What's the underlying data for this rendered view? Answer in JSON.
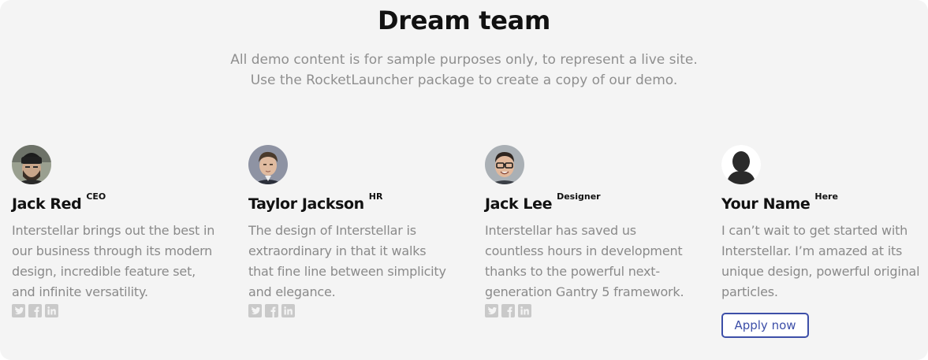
{
  "section": {
    "title": "Dream team",
    "subtitle_lines": [
      "All demo content is for sample purposes only, to represent a live site.",
      "Use the RocketLauncher package to create a copy of our demo."
    ]
  },
  "members": [
    {
      "name": "Jack Red",
      "role": "CEO",
      "description": "Interstellar brings out the best in our business through its modern design, incredible feature set, and infinite versatility.",
      "avatar": "photo-man-beanie-beard",
      "socials": [
        "twitter-icon",
        "facebook-icon",
        "linkedin-icon"
      ]
    },
    {
      "name": "Taylor Jackson",
      "role": "HR",
      "description": "The design of Interstellar is extraordinary in that it walks that fine line between simplicity and elegance.",
      "avatar": "photo-young-man",
      "socials": [
        "twitter-icon",
        "facebook-icon",
        "linkedin-icon"
      ]
    },
    {
      "name": "Jack Lee",
      "role": "Designer",
      "description": "Interstellar has saved us countless hours in development thanks to the powerful next-generation Gantry 5 framework.",
      "avatar": "photo-man-glasses",
      "socials": [
        "twitter-icon",
        "facebook-icon",
        "linkedin-icon"
      ]
    },
    {
      "name": "Your Name",
      "role": "Here",
      "description": "I can’t wait to get started with Interstellar. I’m amazed at its unique design, powerful original particles.",
      "avatar": "silhouette-placeholder",
      "button_label": "Apply now"
    }
  ],
  "colors": {
    "background": "#f4f4f4",
    "heading": "#111111",
    "muted_text": "#8a8a8a",
    "social_icon": "#c9c9c9",
    "accent": "#3d4fa8"
  }
}
